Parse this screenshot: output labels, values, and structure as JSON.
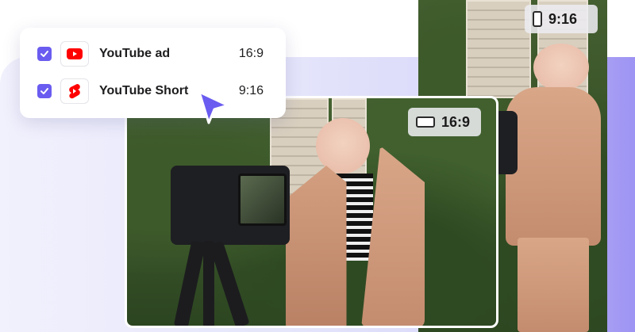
{
  "options": [
    {
      "label": "YouTube ad",
      "ratio": "16:9",
      "checked": true,
      "icon": "youtube-icon"
    },
    {
      "label": "YouTube Short",
      "ratio": "9:16",
      "checked": true,
      "icon": "youtube-shorts-icon"
    }
  ],
  "previews": {
    "vertical_ratio": "9:16",
    "wide_ratio": "16:9"
  },
  "colors": {
    "accent": "#6a5cf0",
    "youtube_red": "#ff0000",
    "panel_light": "#ecebfc",
    "panel_dark": "#9d93f3"
  }
}
